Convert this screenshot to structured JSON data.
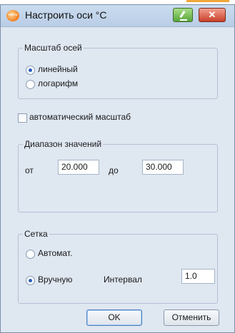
{
  "window": {
    "title": "Настроить оси °C",
    "icon_text": "TESTO",
    "minimize_label": "",
    "close_label": "✕"
  },
  "scale_group": {
    "legend": "Масштаб осей",
    "options": [
      {
        "label": "линейный",
        "checked": true
      },
      {
        "label": "логарифм",
        "checked": false
      }
    ]
  },
  "auto_scale": {
    "label": "автоматический масштаб",
    "checked": false
  },
  "range_group": {
    "legend": "Диапазон значений",
    "from_label": "от",
    "from_value": "20.000",
    "to_label": "до",
    "to_value": "30.000"
  },
  "grid_group": {
    "legend": "Сетка",
    "auto_label": "Автомат.",
    "auto_checked": false,
    "manual_label": "Вручную",
    "manual_checked": true,
    "interval_label": "Интервал",
    "interval_value": "1.0"
  },
  "buttons": {
    "ok": "OK",
    "cancel": "Отменить"
  }
}
